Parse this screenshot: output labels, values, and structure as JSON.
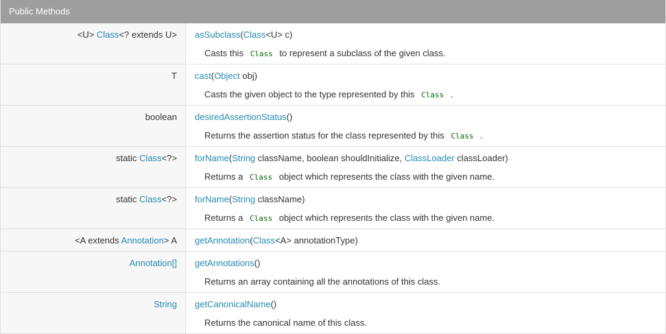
{
  "header": {
    "title": "Public Methods"
  },
  "rows": [
    {
      "type": [
        "<U> ",
        "Class",
        "<? extends U>"
      ],
      "method": "asSubclass",
      "params": [
        "(",
        "Class",
        "<U> c)"
      ],
      "desc": [
        "Casts this ",
        "Class",
        " to represent a subclass of the given class."
      ]
    },
    {
      "type": [
        "T"
      ],
      "method": "cast",
      "params": [
        "(",
        "Object",
        " obj)"
      ],
      "desc": [
        "Casts the given object to the type represented by this ",
        "Class",
        " ."
      ]
    },
    {
      "type": [
        "boolean"
      ],
      "method": "desiredAssertionStatus",
      "params": [
        "()"
      ],
      "desc": [
        "Returns the assertion status for the class represented by this ",
        "Class",
        " ."
      ]
    },
    {
      "type": [
        "static ",
        "Class",
        "<?>"
      ],
      "method": "forName",
      "params": [
        "(",
        "String",
        " className, boolean shouldInitialize, ",
        "ClassLoader",
        " classLoader)"
      ],
      "desc": [
        "Returns a ",
        "Class",
        " object which represents the class with the given name."
      ]
    },
    {
      "type": [
        "static ",
        "Class",
        "<?>"
      ],
      "method": "forName",
      "params": [
        "(",
        "String",
        " className)"
      ],
      "desc": [
        "Returns a ",
        "Class",
        " object which represents the class with the given name."
      ]
    },
    {
      "type": [
        "<A extends ",
        "Annotation",
        "> A"
      ],
      "method": "getAnnotation",
      "params": [
        "(",
        "Class",
        "<A> annotationType)"
      ]
    },
    {
      "type": [
        "Annotation[]"
      ],
      "method": "getAnnotations",
      "params": [
        "()"
      ],
      "desc": [
        "Returns an array containing all the annotations of this class."
      ]
    },
    {
      "type": [
        "String"
      ],
      "method": "getCanonicalName",
      "params": [
        "()"
      ],
      "desc": [
        "Returns the canonical name of this class."
      ]
    }
  ]
}
